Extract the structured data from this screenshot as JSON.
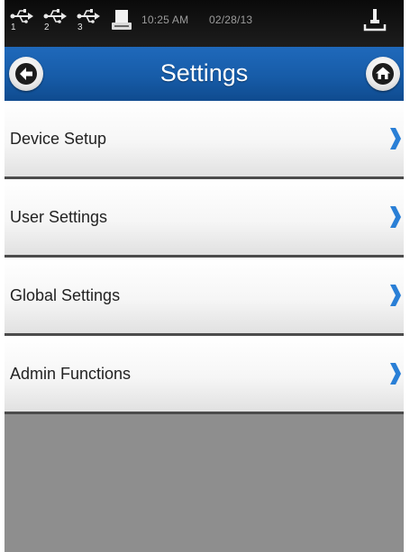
{
  "status_bar": {
    "usb_ports": [
      "1",
      "2",
      "3"
    ],
    "time": "10:25 AM",
    "date": "02/28/13",
    "icons": [
      "usb-icon",
      "printer-icon",
      "network-icon"
    ]
  },
  "header": {
    "title": "Settings",
    "back_icon": "arrow-left-icon",
    "home_icon": "home-icon",
    "color": "#1a62b2"
  },
  "menu": {
    "items": [
      {
        "label": "Device Setup"
      },
      {
        "label": "User Settings"
      },
      {
        "label": "Global Settings"
      },
      {
        "label": "Admin Functions"
      }
    ],
    "chevron_icon": "chevron-right-icon",
    "chevron_color": "#2a7fd6"
  }
}
